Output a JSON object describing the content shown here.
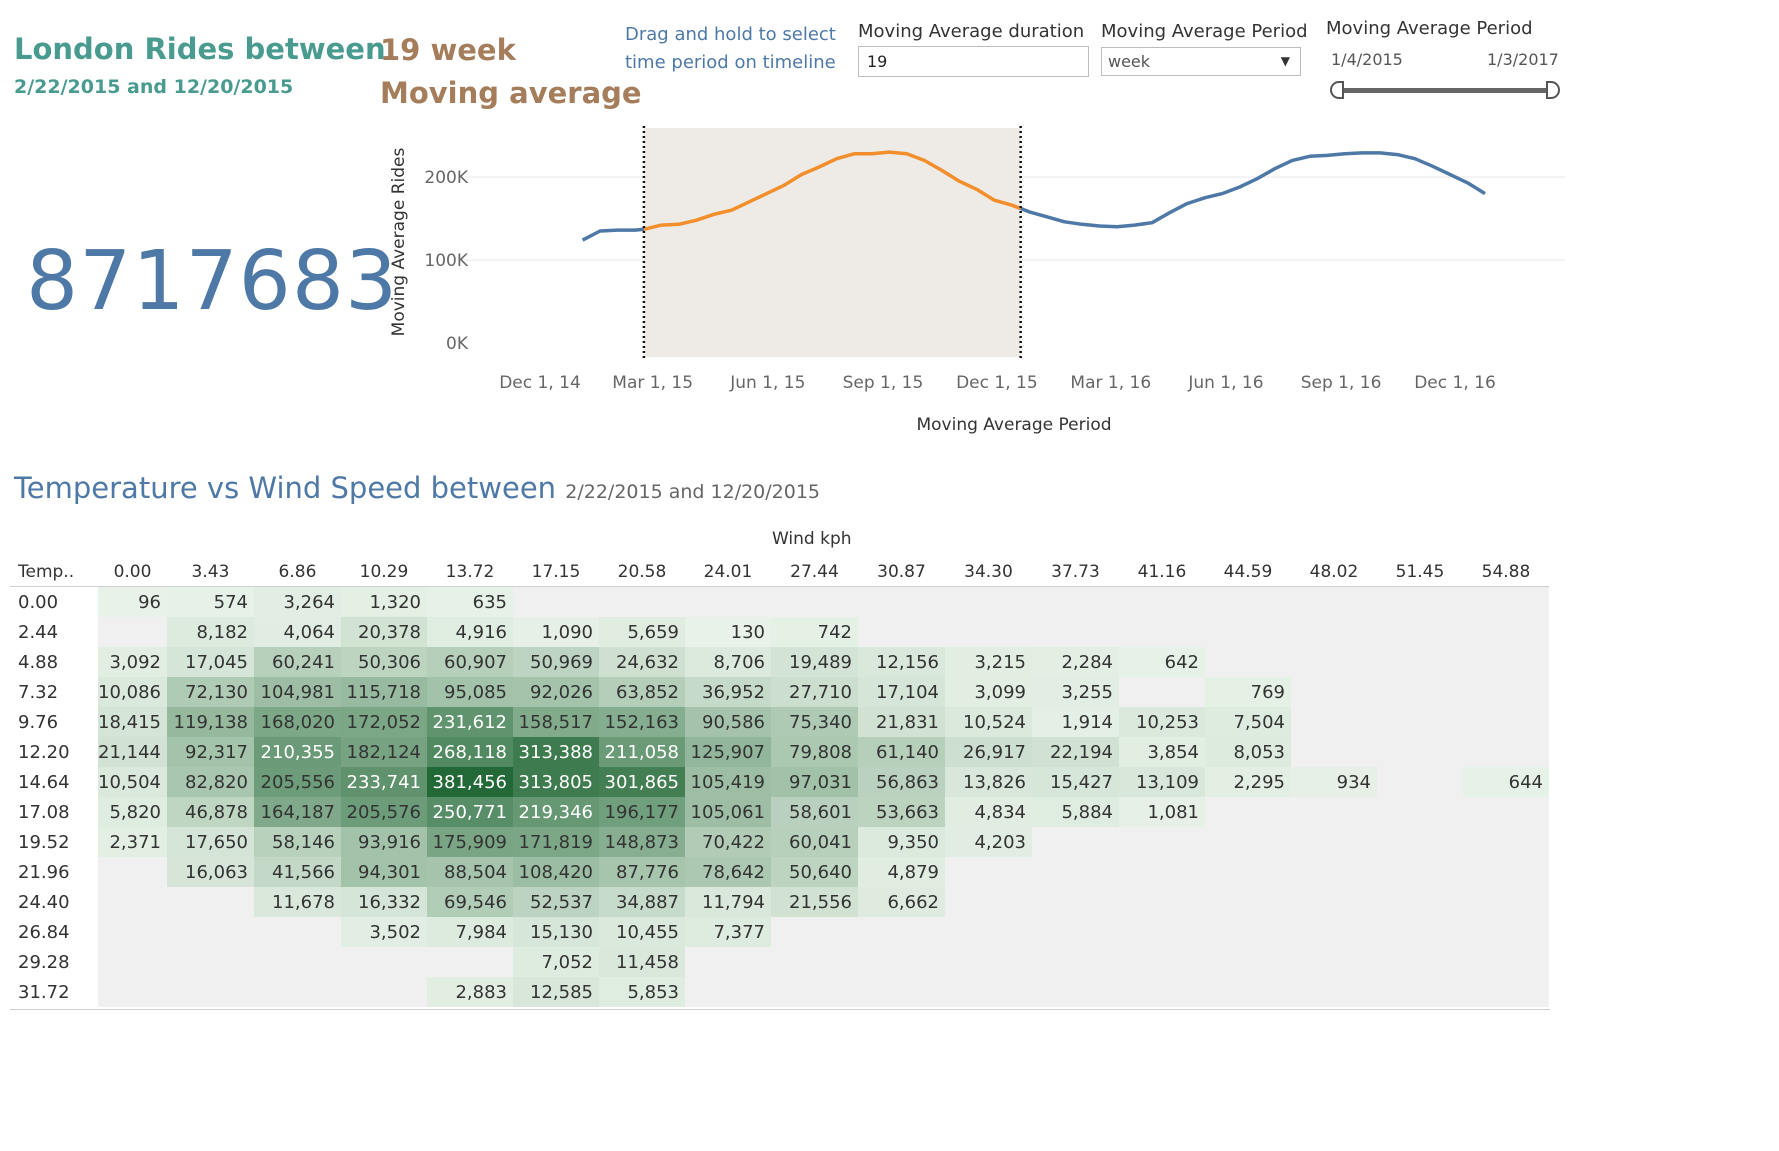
{
  "header": {
    "title": "London Rides between",
    "dates": "2/22/2015 and 12/20/2015",
    "ma_line1": "19 week",
    "ma_line2": "Moving average",
    "hint_line1": "Drag and hold to select",
    "hint_line2": "time period on timeline"
  },
  "controls": {
    "duration_label": "Moving Average duration",
    "duration_value": "19",
    "period_label": "Moving Average Period",
    "period_value": "week",
    "range_label": "Moving Average Period",
    "range_start": "1/4/2015",
    "range_end": "1/3/2017"
  },
  "total_rides": "8717683",
  "chart_data": {
    "type": "line",
    "xlabel": "Moving Average Period",
    "ylabel": "Moving Average Rides",
    "y_ticks": [
      "0K",
      "100K",
      "200K"
    ],
    "x_ticks": [
      "Dec 1, 14",
      "Mar 1, 15",
      "Jun 1, 15",
      "Sep 1, 15",
      "Dec 1, 15",
      "Mar 1, 16",
      "Jun 1, 16",
      "Sep 1, 16",
      "Dec 1, 16"
    ],
    "ylim": [
      0,
      260000
    ],
    "selection": [
      "2015-02-22",
      "2015-12-20"
    ],
    "colors": {
      "line": "#4e79a7",
      "selected": "#f28e2b",
      "shade": "#eeeae6"
    },
    "series": [
      {
        "dates": [
          "2015-01-04",
          "2015-01-18",
          "2015-02-01",
          "2015-02-15",
          "2015-02-22",
          "2015-03-08",
          "2015-03-22",
          "2015-04-05",
          "2015-04-19",
          "2015-05-03",
          "2015-05-17",
          "2015-05-31",
          "2015-06-14",
          "2015-06-28",
          "2015-07-12",
          "2015-07-26",
          "2015-08-09",
          "2015-08-23",
          "2015-09-06",
          "2015-09-20",
          "2015-10-04",
          "2015-10-18",
          "2015-11-01",
          "2015-11-15",
          "2015-11-29",
          "2015-12-13",
          "2015-12-20",
          "2015-12-27",
          "2016-01-10",
          "2016-01-24",
          "2016-02-07",
          "2016-02-21",
          "2016-03-06",
          "2016-03-20",
          "2016-04-03",
          "2016-04-17",
          "2016-05-01",
          "2016-05-15",
          "2016-05-29",
          "2016-06-12",
          "2016-06-26",
          "2016-07-10",
          "2016-07-24",
          "2016-08-07",
          "2016-08-21",
          "2016-09-04",
          "2016-09-18",
          "2016-10-02",
          "2016-10-16",
          "2016-10-30",
          "2016-11-13",
          "2016-11-27",
          "2016-12-11",
          "2016-12-25"
        ],
        "values": [
          124000,
          135000,
          136000,
          136000,
          137000,
          142000,
          143000,
          148000,
          155000,
          160000,
          170000,
          180000,
          190000,
          203000,
          212000,
          222000,
          228000,
          228000,
          230000,
          228000,
          220000,
          208000,
          195000,
          185000,
          172000,
          166000,
          162000,
          158000,
          152000,
          146000,
          143000,
          141000,
          140000,
          142000,
          145000,
          157000,
          168000,
          175000,
          180000,
          188000,
          198000,
          210000,
          220000,
          225000,
          226000,
          228000,
          229000,
          229000,
          227000,
          222000,
          213000,
          203000,
          193000,
          180000
        ]
      }
    ]
  },
  "heatmap": {
    "title": "Temperature vs Wind Speed  between",
    "subtitle": "2/22/2015 and 12/20/2015",
    "col_group_label": "Wind kph",
    "row_header": "Temp..",
    "columns": [
      "0.00",
      "3.43",
      "6.86",
      "10.29",
      "13.72",
      "17.15",
      "20.58",
      "24.01",
      "27.44",
      "30.87",
      "34.30",
      "37.73",
      "41.16",
      "44.59",
      "48.02",
      "51.45",
      "54.88"
    ],
    "rows": [
      {
        "temp": "0.00",
        "cells": [
          "96",
          "574",
          "3,264",
          "1,320",
          "635",
          "",
          "",
          "",
          "",
          "",
          "",
          "",
          "",
          "",
          "",
          "",
          ""
        ]
      },
      {
        "temp": "2.44",
        "cells": [
          "",
          "8,182",
          "4,064",
          "20,378",
          "4,916",
          "1,090",
          "5,659",
          "130",
          "742",
          "",
          "",
          "",
          "",
          "",
          "",
          "",
          ""
        ]
      },
      {
        "temp": "4.88",
        "cells": [
          "3,092",
          "17,045",
          "60,241",
          "50,306",
          "60,907",
          "50,969",
          "24,632",
          "8,706",
          "19,489",
          "12,156",
          "3,215",
          "2,284",
          "642",
          "",
          "",
          "",
          ""
        ]
      },
      {
        "temp": "7.32",
        "cells": [
          "10,086",
          "72,130",
          "104,981",
          "115,718",
          "95,085",
          "92,026",
          "63,852",
          "36,952",
          "27,710",
          "17,104",
          "3,099",
          "3,255",
          "",
          "769",
          "",
          "",
          ""
        ]
      },
      {
        "temp": "9.76",
        "cells": [
          "18,415",
          "119,138",
          "168,020",
          "172,052",
          "231,612",
          "158,517",
          "152,163",
          "90,586",
          "75,340",
          "21,831",
          "10,524",
          "1,914",
          "10,253",
          "7,504",
          "",
          "",
          ""
        ]
      },
      {
        "temp": "12.20",
        "cells": [
          "21,144",
          "92,317",
          "210,355",
          "182,124",
          "268,118",
          "313,388",
          "211,058",
          "125,907",
          "79,808",
          "61,140",
          "26,917",
          "22,194",
          "3,854",
          "8,053",
          "",
          "",
          ""
        ]
      },
      {
        "temp": "14.64",
        "cells": [
          "10,504",
          "82,820",
          "205,556",
          "233,741",
          "381,456",
          "313,805",
          "301,865",
          "105,419",
          "97,031",
          "56,863",
          "13,826",
          "15,427",
          "13,109",
          "2,295",
          "934",
          "",
          "644"
        ]
      },
      {
        "temp": "17.08",
        "cells": [
          "5,820",
          "46,878",
          "164,187",
          "205,576",
          "250,771",
          "219,346",
          "196,177",
          "105,061",
          "58,601",
          "53,663",
          "4,834",
          "5,884",
          "1,081",
          "",
          "",
          "",
          ""
        ]
      },
      {
        "temp": "19.52",
        "cells": [
          "2,371",
          "17,650",
          "58,146",
          "93,916",
          "175,909",
          "171,819",
          "148,873",
          "70,422",
          "60,041",
          "9,350",
          "4,203",
          "",
          "",
          "",
          "",
          "",
          ""
        ]
      },
      {
        "temp": "21.96",
        "cells": [
          "",
          "16,063",
          "41,566",
          "94,301",
          "88,504",
          "108,420",
          "87,776",
          "78,642",
          "50,640",
          "4,879",
          "",
          "",
          "",
          "",
          "",
          "",
          ""
        ]
      },
      {
        "temp": "24.40",
        "cells": [
          "",
          "",
          "11,678",
          "16,332",
          "69,546",
          "52,537",
          "34,887",
          "11,794",
          "21,556",
          "6,662",
          "",
          "",
          "",
          "",
          "",
          "",
          ""
        ]
      },
      {
        "temp": "26.84",
        "cells": [
          "",
          "",
          "",
          "3,502",
          "7,984",
          "15,130",
          "10,455",
          "7,377",
          "",
          "",
          "",
          "",
          "",
          "",
          "",
          "",
          ""
        ]
      },
      {
        "temp": "29.28",
        "cells": [
          "",
          "",
          "",
          "",
          "",
          "7,052",
          "11,458",
          "",
          "",
          "",
          "",
          "",
          "",
          "",
          "",
          "",
          ""
        ]
      },
      {
        "temp": "31.72",
        "cells": [
          "",
          "",
          "",
          "",
          "2,883",
          "12,585",
          "5,853",
          "",
          "",
          "",
          "",
          "",
          "",
          "",
          "",
          "",
          ""
        ]
      }
    ]
  }
}
